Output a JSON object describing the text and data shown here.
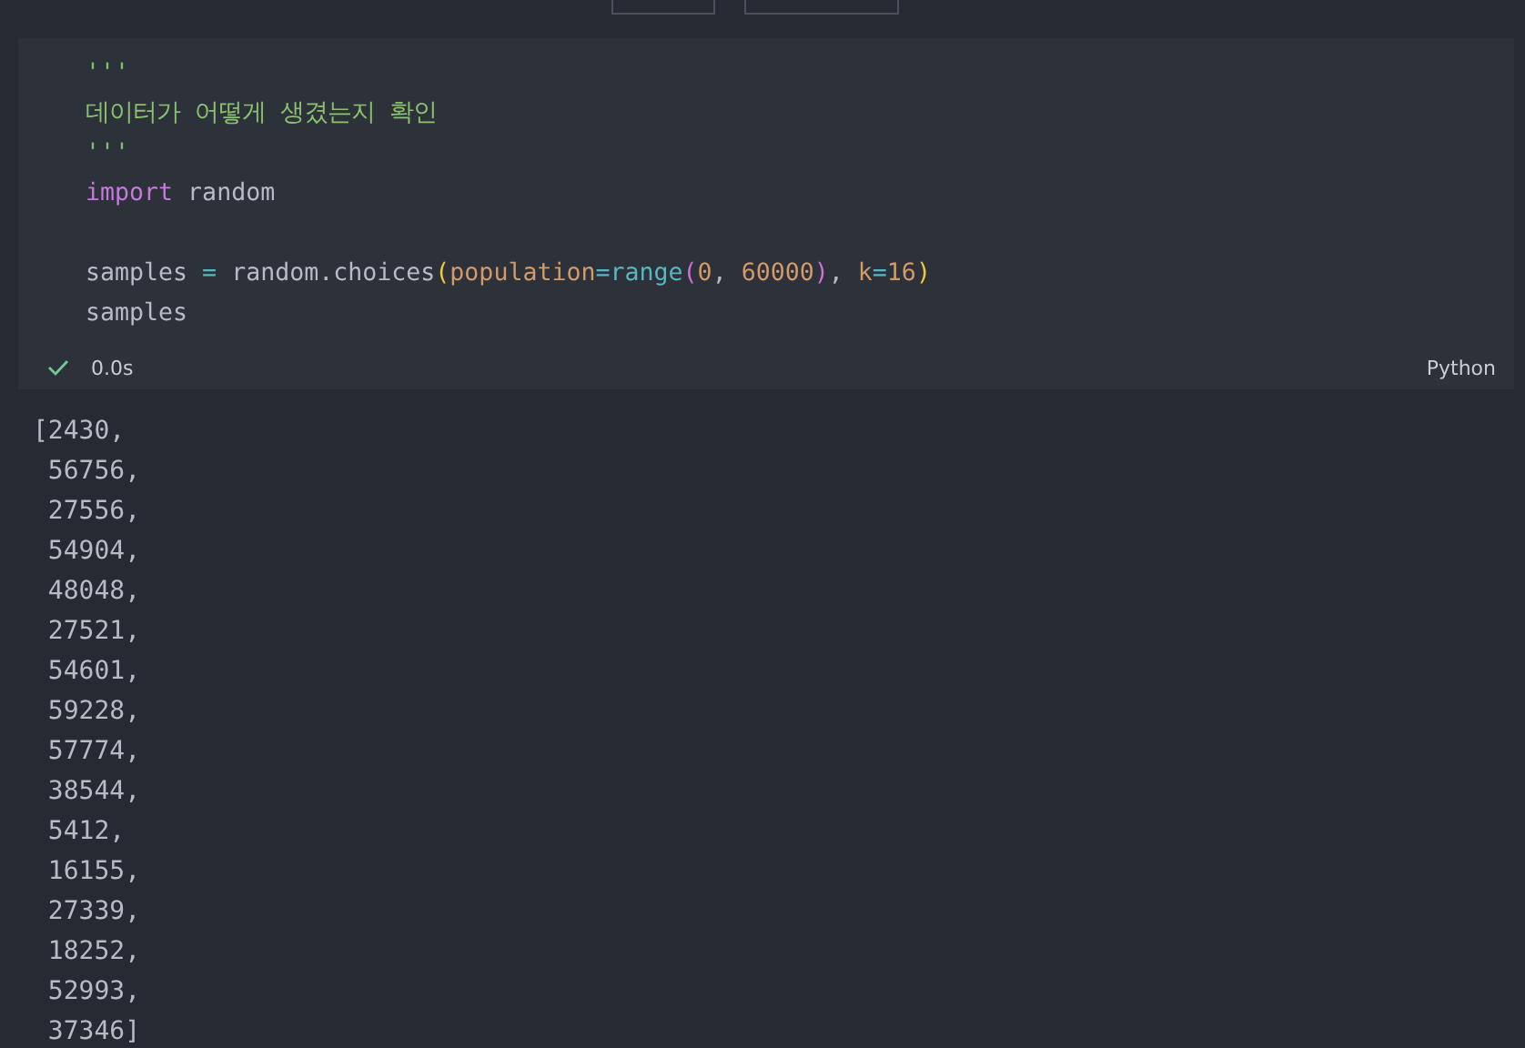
{
  "toolbar": {
    "buttons": [
      {
        "kind": "code"
      },
      {
        "kind": "markdown"
      }
    ]
  },
  "cell": {
    "lines": [
      [
        {
          "kind": "string",
          "text": "'''"
        }
      ],
      [
        {
          "kind": "string",
          "text": "데이터가 어떻게 생겼는지 확인"
        }
      ],
      [
        {
          "kind": "string",
          "text": "'''"
        }
      ],
      [
        {
          "kind": "keyword",
          "text": "import"
        },
        {
          "kind": "plain",
          "text": " random"
        }
      ],
      [
        {
          "kind": "blank"
        }
      ],
      [
        {
          "kind": "plain",
          "text": "samples "
        },
        {
          "kind": "operator",
          "text": "="
        },
        {
          "kind": "plain",
          "text": " random.choices"
        },
        {
          "kind": "bracket1",
          "text": "("
        },
        {
          "kind": "param",
          "text": "population"
        },
        {
          "kind": "operator",
          "text": "="
        },
        {
          "kind": "builtin",
          "text": "range"
        },
        {
          "kind": "bracket2",
          "text": "("
        },
        {
          "kind": "number",
          "text": "0"
        },
        {
          "kind": "plain",
          "text": ", "
        },
        {
          "kind": "number",
          "text": "60000"
        },
        {
          "kind": "bracket2",
          "text": ")"
        },
        {
          "kind": "plain",
          "text": ", "
        },
        {
          "kind": "param",
          "text": "k"
        },
        {
          "kind": "operator",
          "text": "="
        },
        {
          "kind": "number",
          "text": "16"
        },
        {
          "kind": "bracket1",
          "text": ")"
        }
      ],
      [
        {
          "kind": "plain",
          "text": "samples"
        }
      ]
    ],
    "status": {
      "success": true,
      "time": "0.0s"
    },
    "language": "Python"
  },
  "output": {
    "lines": [
      "[2430,",
      " 56756,",
      " 27556,",
      " 54904,",
      " 48048,",
      " 27521,",
      " 54601,",
      " 59228,",
      " 57774,",
      " 38544,",
      " 5412,",
      " 16155,",
      " 27339,",
      " 18252,",
      " 52993,",
      " 37346]"
    ]
  }
}
